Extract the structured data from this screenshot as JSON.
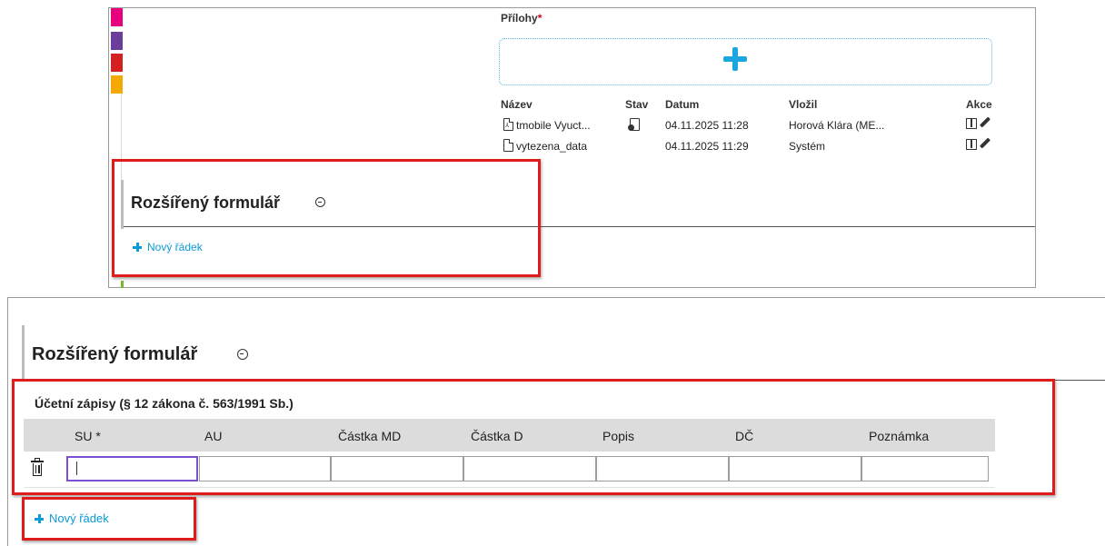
{
  "attachments": {
    "title": "Přílohy",
    "required_mark": "*",
    "columns": {
      "name": "Název",
      "status": "Stav",
      "date": "Datum",
      "uploaded_by": "Vložil",
      "actions": "Akce"
    },
    "rows": [
      {
        "icon": "pdf-file-icon",
        "name": "tmobile Vyuct...",
        "status_icon": "signed-file-icon",
        "date": "04.11.2025 11:28",
        "uploaded_by": "Horová Klára (ME..."
      },
      {
        "icon": "file-icon",
        "name": "vytezena_data",
        "status_icon": "",
        "date": "04.11.2025 11:29",
        "uploaded_by": "Systém"
      }
    ],
    "action_icons": [
      "split-view-icon",
      "edit-pencil-icon"
    ]
  },
  "section": {
    "title": "Rozšířený formulář",
    "add_row_label": "Nový řádek"
  },
  "ledger": {
    "title": "Účetní zápisy (§ 12 zákona č. 563/1991 Sb.)",
    "columns": [
      "SU *",
      "AU",
      "Částka MD",
      "Částka D",
      "Popis",
      "DČ",
      "Poznámka"
    ],
    "row_values": [
      "",
      "",
      "",
      "",
      "",
      "",
      ""
    ]
  },
  "colors": {
    "accent": "#1ba6e0",
    "link": "#0a9ad6",
    "highlight": "#e01b1b",
    "active_input": "#7b4fd1",
    "strip": [
      "#e6007e",
      "#6a3d9a",
      "#d32020",
      "#f5a800"
    ],
    "status_green": "#77b82a"
  }
}
